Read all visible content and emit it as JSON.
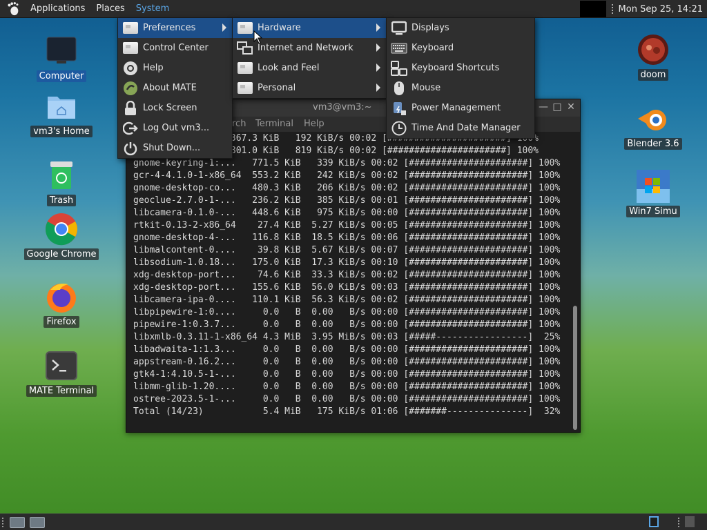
{
  "top_panel": {
    "menus": [
      "Applications",
      "Places",
      "System"
    ],
    "active_menu": "System",
    "clock": "Mon Sep 25, 14:21"
  },
  "desktop_icons_left": [
    {
      "label": "Computer",
      "icon": "computer-icon",
      "selected": true
    },
    {
      "label": "vm3's Home",
      "icon": "home-folder-icon",
      "selected": false
    },
    {
      "label": "Trash",
      "icon": "trash-icon",
      "selected": false
    },
    {
      "label": "Google Chrome",
      "icon": "chrome-icon",
      "selected": false
    },
    {
      "label": "Firefox",
      "icon": "firefox-icon",
      "selected": false
    },
    {
      "label": "MATE Terminal",
      "icon": "terminal-icon",
      "selected": false
    }
  ],
  "desktop_icons_right": [
    {
      "label": "doom",
      "icon": "doom-icon"
    },
    {
      "label": "Blender 3.6",
      "icon": "blender-icon"
    },
    {
      "label": "Win7 Simu",
      "icon": "win7-icon"
    }
  ],
  "system_menu": [
    {
      "label": "Preferences",
      "icon": "preferences-icon",
      "submenu": true,
      "highlighted": true
    },
    {
      "label": "Control Center",
      "icon": "control-center-icon",
      "submenu": false
    },
    {
      "label": "Help",
      "icon": "help-icon",
      "submenu": false
    },
    {
      "label": "About MATE",
      "icon": "mate-logo-icon",
      "submenu": false
    },
    {
      "label": "Lock Screen",
      "icon": "lock-icon",
      "submenu": false
    },
    {
      "label": "Log Out vm3...",
      "icon": "logout-icon",
      "submenu": false
    },
    {
      "label": "Shut Down...",
      "icon": "power-icon",
      "submenu": false
    }
  ],
  "preferences_menu": [
    {
      "label": "Hardware",
      "icon": "hardware-folder-icon",
      "highlighted": true
    },
    {
      "label": "Internet and Network",
      "icon": "network-icon",
      "highlighted": false
    },
    {
      "label": "Look and Feel",
      "icon": "look-feel-folder-icon",
      "highlighted": false
    },
    {
      "label": "Personal",
      "icon": "personal-folder-icon",
      "highlighted": false
    }
  ],
  "hardware_menu": [
    {
      "label": "Displays",
      "icon": "display-icon"
    },
    {
      "label": "Keyboard",
      "icon": "keyboard-icon"
    },
    {
      "label": "Keyboard Shortcuts",
      "icon": "keyboard-shortcuts-icon"
    },
    {
      "label": "Mouse",
      "icon": "mouse-icon"
    },
    {
      "label": "Power Management",
      "icon": "power-management-icon"
    },
    {
      "label": "Time And Date Manager",
      "icon": "clock-icon"
    }
  ],
  "terminal": {
    "title": "vm3@vm3:~",
    "menus": [
      "rch",
      "Terminal",
      "Help"
    ],
    "lines": [
      "                  367.3 KiB   192 KiB/s 00:02 [######################] 100%",
      "                 1801.0 KiB   819 KiB/s 00:02 [######################] 100%",
      "gnome-keyring-1:...   771.5 KiB   339 KiB/s 00:02 [######################] 100%",
      "gcr-4-4.1.0-1-x86_64  553.2 KiB   242 KiB/s 00:02 [######################] 100%",
      "gnome-desktop-co...   480.3 KiB   206 KiB/s 00:02 [######################] 100%",
      "geoclue-2.7.0-1-...   236.2 KiB   385 KiB/s 00:01 [######################] 100%",
      "libcamera-0.1.0-...   448.6 KiB   975 KiB/s 00:00 [######################] 100%",
      "rtkit-0.13-2-x86_64    27.4 KiB  5.27 KiB/s 00:05 [######################] 100%",
      "gnome-desktop-4-...   116.8 KiB  18.5 KiB/s 00:06 [######################] 100%",
      "libmalcontent-0....    39.8 KiB  5.67 KiB/s 00:07 [######################] 100%",
      "libsodium-1.0.18...   175.0 KiB  17.3 KiB/s 00:10 [######################] 100%",
      "xdg-desktop-port...    74.6 KiB  33.3 KiB/s 00:02 [######################] 100%",
      "xdg-desktop-port...   155.6 KiB  56.0 KiB/s 00:03 [######################] 100%",
      "libcamera-ipa-0....   110.1 KiB  56.3 KiB/s 00:02 [######################] 100%",
      "libpipewire-1:0....     0.0   B  0.00   B/s 00:00 [######################] 100%",
      "pipewire-1:0.3.7...     0.0   B  0.00   B/s 00:00 [######################] 100%",
      "libxmlb-0.3.11-1-x86_64 4.3 MiB  3.95 MiB/s 00:03 [#####-----------------]  25%",
      "libadwaita-1:1.3...     0.0   B  0.00   B/s 00:00 [######################] 100%",
      "appstream-0.16.2...     0.0   B  0.00   B/s 00:00 [######################] 100%",
      "gtk4-1:4.10.5-1-...     0.0   B  0.00   B/s 00:00 [######################] 100%",
      "libmm-glib-1.20....     0.0   B  0.00   B/s 00:00 [######################] 100%",
      "ostree-2023.5-1-...     0.0   B  0.00   B/s 00:00 [######################] 100%",
      "Total (14/23)           5.4 MiB   175 KiB/s 01:06 [#######---------------]  32%"
    ]
  }
}
